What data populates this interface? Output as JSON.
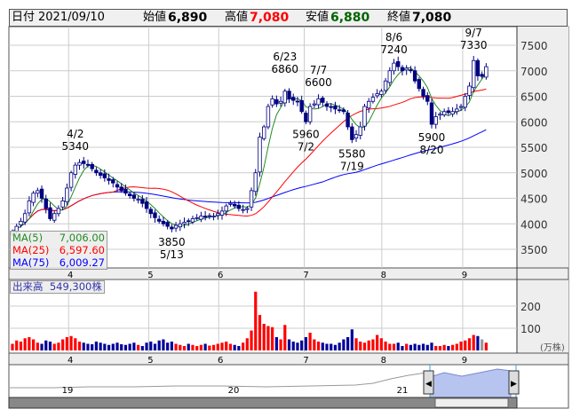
{
  "header": {
    "date_label": "日付",
    "date": "2021/09/10",
    "open_label": "始値",
    "open": "6,890",
    "high_label": "高値",
    "high": "7,080",
    "low_label": "安値",
    "low": "6,880",
    "close_label": "終値",
    "close": "7,080"
  },
  "colors": {
    "up_fill": "#ffffff",
    "down_fill": "#000080",
    "ma5": "#228b22",
    "ma25": "#ff0000",
    "ma75": "#0000ff",
    "vol_up": "#ff0000",
    "vol_down": "#000099"
  },
  "ma_legend": [
    {
      "label": "MA(5)",
      "value": "7,006.00"
    },
    {
      "label": "MA(25)",
      "value": "6,597.60"
    },
    {
      "label": "MA(75)",
      "value": "6,009.27"
    }
  ],
  "volume_label": {
    "label": "出来高",
    "value": "549,300株"
  },
  "navigator": {
    "years": [
      "19",
      "20",
      "21"
    ]
  },
  "chart_data": {
    "type": "candlestick",
    "y_ticks": [
      3500,
      4000,
      4500,
      5000,
      5500,
      6000,
      6500,
      7000,
      7500
    ],
    "vol_ticks": [
      100,
      200
    ],
    "vol_unit": "(万株)",
    "months": [
      {
        "label": "4",
        "index": 13.4
      },
      {
        "label": "5",
        "index": 32.5
      },
      {
        "label": "6",
        "index": 49.2
      },
      {
        "label": "7",
        "index": 69.6
      },
      {
        "label": "8",
        "index": 88.1
      },
      {
        "label": "9",
        "index": 107.4
      }
    ],
    "closes": [
      3850,
      3950,
      4050,
      4200,
      4450,
      4600,
      4650,
      4500,
      4300,
      4100,
      4200,
      4300,
      4450,
      4700,
      5000,
      5150,
      5200,
      5180,
      5150,
      5080,
      5000,
      4950,
      4900,
      4850,
      4800,
      4720,
      4650,
      4600,
      4550,
      4500,
      4480,
      4400,
      4300,
      4200,
      4120,
      4050,
      4000,
      3950,
      3900,
      3970,
      4000,
      4030,
      4050,
      4100,
      4120,
      4150,
      4130,
      4160,
      4150,
      4200,
      4250,
      4350,
      4400,
      4350,
      4300,
      4280,
      4300,
      4650,
      5000,
      5700,
      5900,
      6300,
      6450,
      6350,
      6400,
      6600,
      6450,
      6420,
      6400,
      6200,
      6000,
      6300,
      6350,
      6450,
      6380,
      6300,
      6280,
      6250,
      6220,
      6200,
      5900,
      5650,
      5750,
      5900,
      6300,
      6400,
      6480,
      6550,
      6600,
      6800,
      7000,
      7150,
      7080,
      7000,
      7050,
      7000,
      6800,
      6650,
      6500,
      6400,
      5950,
      6100,
      6150,
      6200,
      6180,
      6200,
      6250,
      6300,
      6500,
      6700,
      7200,
      6900,
      6890,
      7080
    ],
    "volumes": [
      30,
      45,
      40,
      55,
      60,
      50,
      35,
      30,
      45,
      40,
      30,
      35,
      50,
      60,
      65,
      55,
      40,
      35,
      30,
      28,
      40,
      35,
      30,
      25,
      30,
      35,
      28,
      25,
      30,
      35,
      25,
      20,
      35,
      40,
      30,
      45,
      50,
      35,
      40,
      30,
      25,
      20,
      30,
      25,
      20,
      25,
      30,
      22,
      25,
      30,
      35,
      40,
      30,
      25,
      20,
      35,
      55,
      90,
      265,
      160,
      120,
      110,
      105,
      60,
      50,
      115,
      50,
      40,
      35,
      45,
      60,
      80,
      50,
      40,
      35,
      30,
      30,
      25,
      35,
      50,
      60,
      95,
      55,
      40,
      35,
      45,
      50,
      70,
      55,
      40,
      30,
      30,
      35,
      20,
      30,
      25,
      30,
      25,
      30,
      25,
      35,
      20,
      20,
      25,
      20,
      25,
      30,
      40,
      45,
      55,
      70,
      65,
      50,
      35,
      55
    ],
    "annotations": [
      {
        "text": [
          "4/2",
          "5340"
        ],
        "index": 15,
        "price": 5340,
        "pos": "above"
      },
      {
        "text": [
          "3850",
          "5/13"
        ],
        "index": 38,
        "price": 3850,
        "pos": "below"
      },
      {
        "text": [
          "6/23",
          "6860"
        ],
        "index": 65,
        "price": 6860,
        "pos": "above"
      },
      {
        "text": [
          "5960",
          "7/2"
        ],
        "index": 70,
        "price": 5960,
        "pos": "below"
      },
      {
        "text": [
          "7/7",
          "6600"
        ],
        "index": 73,
        "price": 6600,
        "pos": "above"
      },
      {
        "text": [
          "5580",
          "7/19"
        ],
        "index": 81,
        "price": 5580,
        "pos": "below"
      },
      {
        "text": [
          "8/6",
          "7240"
        ],
        "index": 91,
        "price": 7240,
        "pos": "above"
      },
      {
        "text": [
          "5900",
          "8/20"
        ],
        "index": 100,
        "price": 5900,
        "pos": "below"
      },
      {
        "text": [
          "9/7",
          "7330"
        ],
        "index": 110,
        "price": 7330,
        "pos": "above"
      }
    ]
  }
}
